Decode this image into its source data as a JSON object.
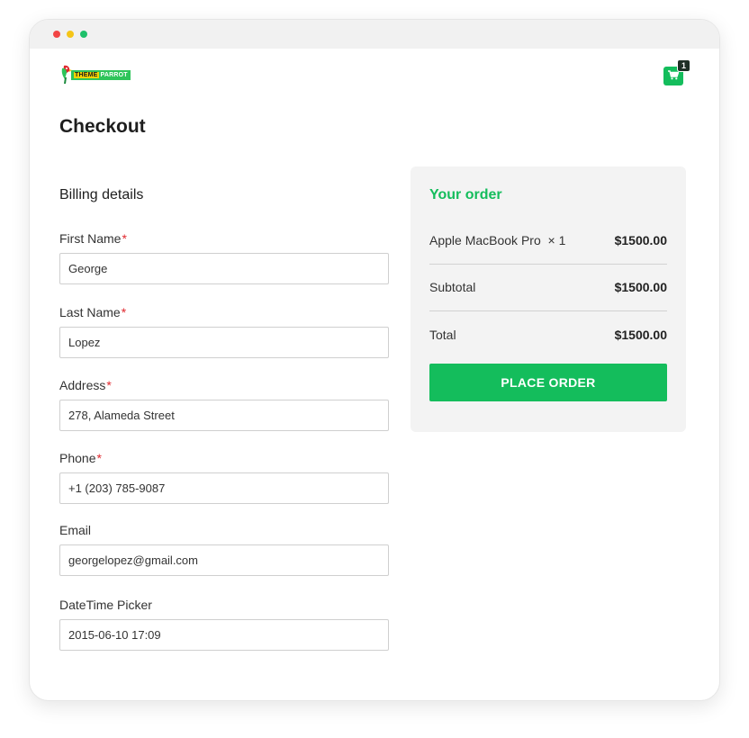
{
  "window": {
    "controls": [
      "close-dot",
      "minimize-dot",
      "maximize-dot"
    ]
  },
  "header": {
    "logo_text_1": "THEME",
    "logo_text_2": "PARROT",
    "cart_count": "1"
  },
  "page": {
    "title": "Checkout"
  },
  "billing": {
    "title": "Billing details",
    "fields": [
      {
        "label": "First Name",
        "required": "*",
        "value": "George"
      },
      {
        "label": "Last Name",
        "required": "*",
        "value": "Lopez"
      },
      {
        "label": "Address",
        "required": "*",
        "value": "278, Alameda Street"
      },
      {
        "label": "Phone",
        "required": "*",
        "value": "+1 (203) 785-9087"
      },
      {
        "label": "Email",
        "required": "",
        "value": "georgelopez@gmail.com"
      },
      {
        "label": "DateTime Picker",
        "required": "",
        "value": "2015-06-10 17:09"
      }
    ]
  },
  "order": {
    "title": "Your order",
    "item": {
      "name": "Apple MacBook Pro",
      "qty": "× 1",
      "amount": "$1500.00"
    },
    "subtotal": {
      "label": "Subtotal",
      "amount": "$1500.00"
    },
    "total": {
      "label": "Total",
      "amount": "$1500.00"
    },
    "button": "PLACE ORDER"
  },
  "colors": {
    "accent": "#14bd5c",
    "required": "#e0282e",
    "panel": "#f3f3f3"
  }
}
